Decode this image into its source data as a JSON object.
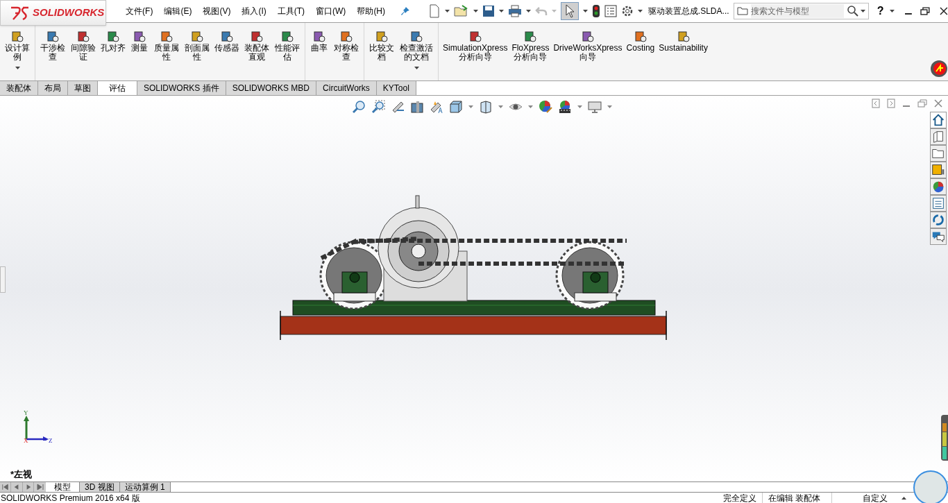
{
  "logo": "SOLIDWORKS",
  "menu": [
    "文件(F)",
    "编辑(E)",
    "视图(V)",
    "插入(I)",
    "工具(T)",
    "窗口(W)",
    "帮助(H)"
  ],
  "document_title": "驱动装置总成.SLDA...",
  "search": {
    "placeholder": "搜索文件与模型"
  },
  "help_label": "?",
  "ribbon_groups": [
    [
      {
        "label": "设计算例",
        "dropdown": true
      }
    ],
    [
      {
        "label": "干涉检查",
        "dropdown": false
      },
      {
        "label": "间隙验证",
        "dropdown": false
      },
      {
        "label": "孔对齐",
        "dropdown": false
      },
      {
        "label": "测量",
        "dropdown": false
      },
      {
        "label": "质量属性",
        "dropdown": false
      },
      {
        "label": "剖面属性",
        "dropdown": false
      },
      {
        "label": "传感器",
        "dropdown": false
      },
      {
        "label": "装配体直观",
        "dropdown": false
      },
      {
        "label": "性能评估",
        "dropdown": false
      }
    ],
    [
      {
        "label": "曲率",
        "dropdown": false
      },
      {
        "label": "对称检查",
        "dropdown": false
      }
    ],
    [
      {
        "label": "比较文档",
        "dropdown": false
      },
      {
        "label": "检查激活的文档",
        "dropdown": true
      }
    ],
    [
      {
        "label": "SimulationXpress\n分析向导",
        "dropdown": false
      },
      {
        "label": "FloXpress\n分析向导",
        "dropdown": false
      },
      {
        "label": "DriveWorksXpress\n向导",
        "dropdown": false
      },
      {
        "label": "Costing",
        "dropdown": false
      },
      {
        "label": "Sustainability",
        "dropdown": false
      }
    ]
  ],
  "ribbon_tabs": [
    {
      "label": "装配体",
      "selected": false
    },
    {
      "label": "布局",
      "selected": false
    },
    {
      "label": "草图",
      "selected": false
    },
    {
      "label": "评估",
      "selected": true
    },
    {
      "label": "SOLIDWORKS 插件",
      "selected": false
    },
    {
      "label": "SOLIDWORKS MBD",
      "selected": false
    },
    {
      "label": "CircuitWorks",
      "selected": false
    },
    {
      "label": "KYTool",
      "selected": false
    }
  ],
  "triad": {
    "y": "Y",
    "x": "X",
    "z": "Z"
  },
  "view_label": "*左视",
  "bottom_tabs": [
    {
      "label": "模型",
      "selected": true
    },
    {
      "label": "3D 视图",
      "selected": false
    },
    {
      "label": "运动算例 1",
      "selected": false
    }
  ],
  "status_bar": {
    "product": "SOLIDWORKS Premium 2016 x64 版",
    "definition": "完全定义",
    "editing": "在编辑 装配体",
    "units": "自定义"
  }
}
